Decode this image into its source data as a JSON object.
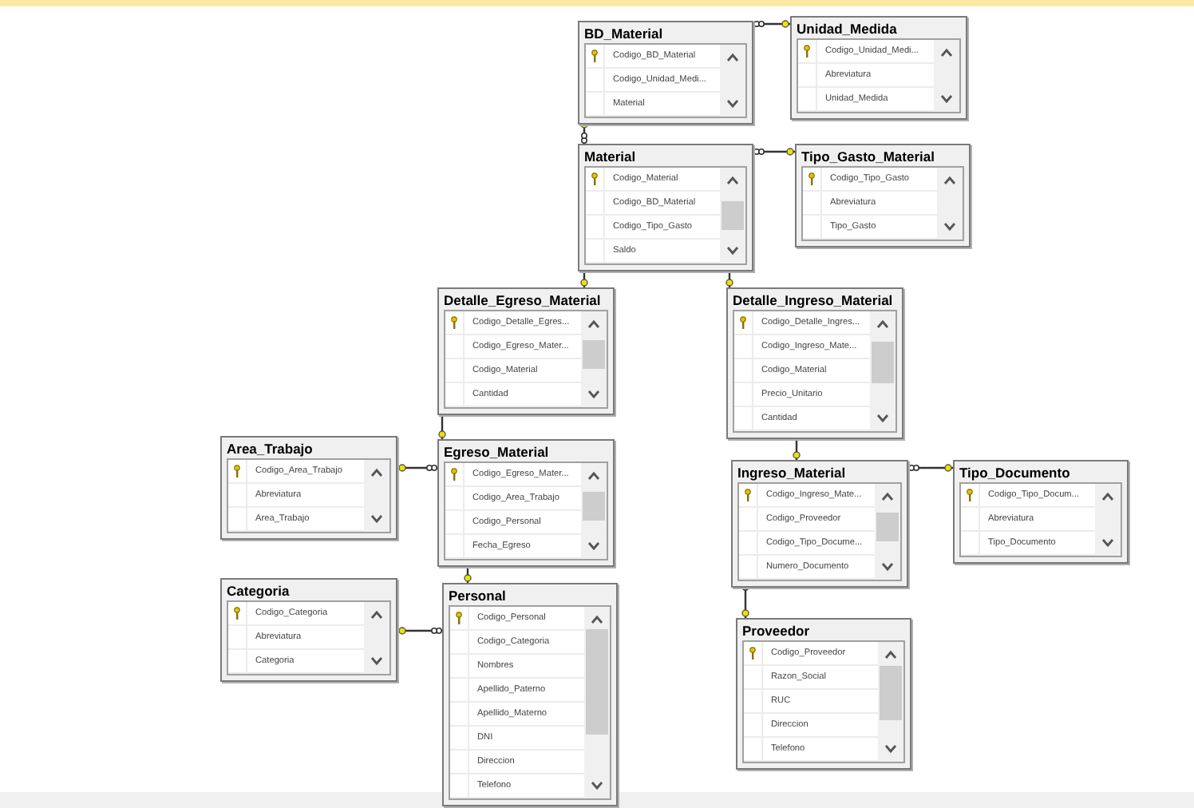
{
  "diagram": {
    "tables": [
      {
        "name": "BD_Material",
        "columns": [
          {
            "name": "Codigo_BD_Material",
            "primary_key": true
          },
          {
            "name": "Codigo_Unidad_Medi...",
            "primary_key": false
          },
          {
            "name": "Material",
            "primary_key": false
          }
        ]
      },
      {
        "name": "Unidad_Medida",
        "columns": [
          {
            "name": "Codigo_Unidad_Medi...",
            "primary_key": true
          },
          {
            "name": "Abreviatura",
            "primary_key": false
          },
          {
            "name": "Unidad_Medida",
            "primary_key": false
          }
        ]
      },
      {
        "name": "Material",
        "columns": [
          {
            "name": "Codigo_Material",
            "primary_key": true
          },
          {
            "name": "Codigo_BD_Material",
            "primary_key": false
          },
          {
            "name": "Codigo_Tipo_Gasto",
            "primary_key": false
          },
          {
            "name": "Saldo",
            "primary_key": false
          }
        ]
      },
      {
        "name": "Tipo_Gasto_Material",
        "columns": [
          {
            "name": "Codigo_Tipo_Gasto",
            "primary_key": true
          },
          {
            "name": "Abreviatura",
            "primary_key": false
          },
          {
            "name": "Tipo_Gasto",
            "primary_key": false
          }
        ]
      },
      {
        "name": "Detalle_Egreso_Material",
        "columns": [
          {
            "name": "Codigo_Detalle_Egres...",
            "primary_key": true
          },
          {
            "name": "Codigo_Egreso_Mater...",
            "primary_key": false
          },
          {
            "name": "Codigo_Material",
            "primary_key": false
          },
          {
            "name": "Cantidad",
            "primary_key": false
          }
        ]
      },
      {
        "name": "Detalle_Ingreso_Material",
        "columns": [
          {
            "name": "Codigo_Detalle_Ingres...",
            "primary_key": true
          },
          {
            "name": "Codigo_Ingreso_Mate...",
            "primary_key": false
          },
          {
            "name": "Codigo_Material",
            "primary_key": false
          },
          {
            "name": "Precio_Unitario",
            "primary_key": false
          },
          {
            "name": "Cantidad",
            "primary_key": false
          }
        ]
      },
      {
        "name": "Area_Trabajo",
        "columns": [
          {
            "name": "Codigo_Area_Trabajo",
            "primary_key": true
          },
          {
            "name": "Abreviatura",
            "primary_key": false
          },
          {
            "name": "Area_Trabajo",
            "primary_key": false
          }
        ]
      },
      {
        "name": "Egreso_Material",
        "columns": [
          {
            "name": "Codigo_Egreso_Mater...",
            "primary_key": true
          },
          {
            "name": "Codigo_Area_Trabajo",
            "primary_key": false
          },
          {
            "name": "Codigo_Personal",
            "primary_key": false
          },
          {
            "name": "Fecha_Egreso",
            "primary_key": false
          }
        ]
      },
      {
        "name": "Ingreso_Material",
        "columns": [
          {
            "name": "Codigo_Ingreso_Mate...",
            "primary_key": true
          },
          {
            "name": "Codigo_Proveedor",
            "primary_key": false
          },
          {
            "name": "Codigo_Tipo_Docume...",
            "primary_key": false
          },
          {
            "name": "Numero_Documento",
            "primary_key": false
          }
        ]
      },
      {
        "name": "Tipo_Documento",
        "columns": [
          {
            "name": "Codigo_Tipo_Docum...",
            "primary_key": true
          },
          {
            "name": "Abreviatura",
            "primary_key": false
          },
          {
            "name": "Tipo_Documento",
            "primary_key": false
          }
        ]
      },
      {
        "name": "Categoria",
        "columns": [
          {
            "name": "Codigo_Categoria",
            "primary_key": true
          },
          {
            "name": "Abreviatura",
            "primary_key": false
          },
          {
            "name": "Categoria",
            "primary_key": false
          }
        ]
      },
      {
        "name": "Personal",
        "columns": [
          {
            "name": "Codigo_Personal",
            "primary_key": true
          },
          {
            "name": "Codigo_Categoria",
            "primary_key": false
          },
          {
            "name": "Nombres",
            "primary_key": false
          },
          {
            "name": "Apellido_Paterno",
            "primary_key": false
          },
          {
            "name": "Apellido_Materno",
            "primary_key": false
          },
          {
            "name": "DNI",
            "primary_key": false
          },
          {
            "name": "Direccion",
            "primary_key": false
          },
          {
            "name": "Telefono",
            "primary_key": false
          }
        ]
      },
      {
        "name": "Proveedor",
        "columns": [
          {
            "name": "Codigo_Proveedor",
            "primary_key": true
          },
          {
            "name": "Razon_Social",
            "primary_key": false
          },
          {
            "name": "RUC",
            "primary_key": false
          },
          {
            "name": "Direccion",
            "primary_key": false
          },
          {
            "name": "Telefono",
            "primary_key": false
          }
        ]
      }
    ]
  }
}
